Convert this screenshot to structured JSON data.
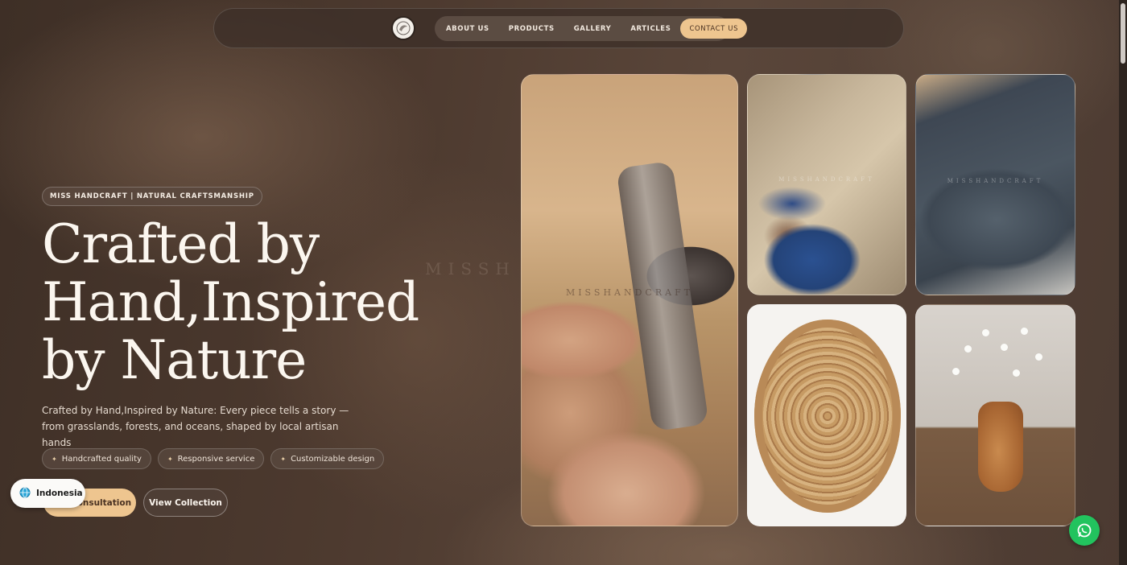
{
  "nav": {
    "items": [
      "ABOUT US",
      "PRODUCTS",
      "GALLERY",
      "ARTICLES"
    ],
    "contact": "CONTACT US"
  },
  "hero": {
    "badge": "MISS HANDCRAFT | NATURAL CRAFTSMANSHIP",
    "headline": "Crafted by Hand,Inspired by Nature",
    "subtitle": "Crafted by Hand,Inspired by Nature: Every piece tells a story — from grasslands, forests, and oceans, shaped by local artisan hands",
    "pills": [
      "Handcrafted quality",
      "Responsive service",
      "Customizable design"
    ],
    "primary_button": "Consultation",
    "secondary_button": "View Collection"
  },
  "watermark": "MISSHANDCRAFT",
  "background_watermark": "MISSH",
  "language": "Indonesia",
  "colors": {
    "accent": "#eec58f",
    "background": "#3f3128",
    "whatsapp": "#22c35e"
  },
  "icons": {
    "logo": "brand-logo-icon",
    "language": "globe-icon",
    "chat": "whatsapp-icon",
    "pill_marker": "sparkle-icon"
  }
}
